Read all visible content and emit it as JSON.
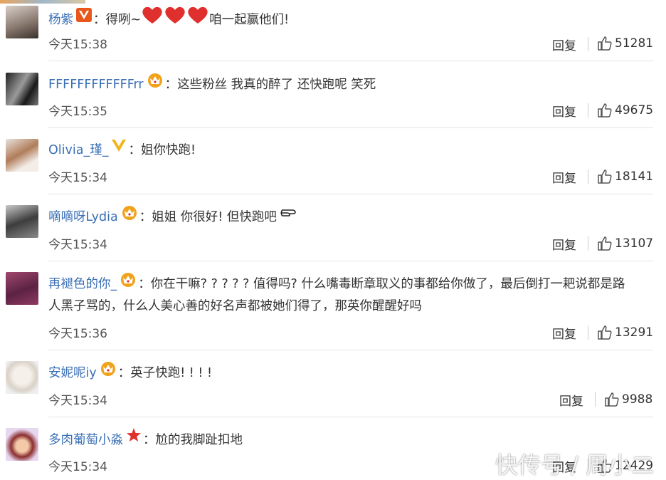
{
  "comments": [
    {
      "user": "杨紫",
      "badge": "v-red",
      "sep": "：",
      "text_before": "得咧~",
      "text_after": "咱一起赢他们!",
      "time": "今天15:38",
      "reply": "回复",
      "likes": "51281",
      "hearts": 3
    },
    {
      "user": "FFFFFFFFFFFFrr",
      "badge": "crown",
      "sep": "：",
      "text": "这些粉丝 我真的醉了 还快跑呢 笑死",
      "time": "今天15:35",
      "reply": "回复",
      "likes": "49675"
    },
    {
      "user": "Olivia_瑾_",
      "badge": "v-gold",
      "sep": "：",
      "text": "姐你快跑!",
      "time": "今天15:34",
      "reply": "回复",
      "likes": "18141"
    },
    {
      "user": "嘀嘀呀Lydia",
      "badge": "crown",
      "sep": "：",
      "text": "姐姐 你很好! 但快跑吧",
      "time": "今天15:34",
      "reply": "回复",
      "likes": "13107"
    },
    {
      "user": "再褪色的你_",
      "badge": "crown",
      "sep": "：",
      "text": "你在干嘛? ? ? ? ? 值得吗? 什么嘴毒断章取义的事都给你做了，最后倒打一耙说都是路",
      "text2": "人黑子骂的，什么人美心善的好名声都被她们得了，那英你醒醒好吗",
      "time": "今天15:36",
      "reply": "回复",
      "likes": "13291"
    },
    {
      "user": "安妮呢iy",
      "badge": "crown",
      "sep": "：",
      "text": "英子快跑! ! ! !",
      "time": "今天15:34",
      "reply": "回复",
      "likes": "9988"
    },
    {
      "user": "多肉葡萄小淼",
      "badge": "star",
      "sep": "：",
      "text": "尬的我脚趾扣地",
      "time": "今天15:34",
      "reply": "回复",
      "likes": "12429"
    }
  ],
  "watermark": "快传号 / 周小二",
  "colors": {
    "username": "#3a6fb5",
    "heart": "#e0302e",
    "crown": "#f0a21a",
    "vred": "#e8581c",
    "vgold": "#f2b418"
  }
}
